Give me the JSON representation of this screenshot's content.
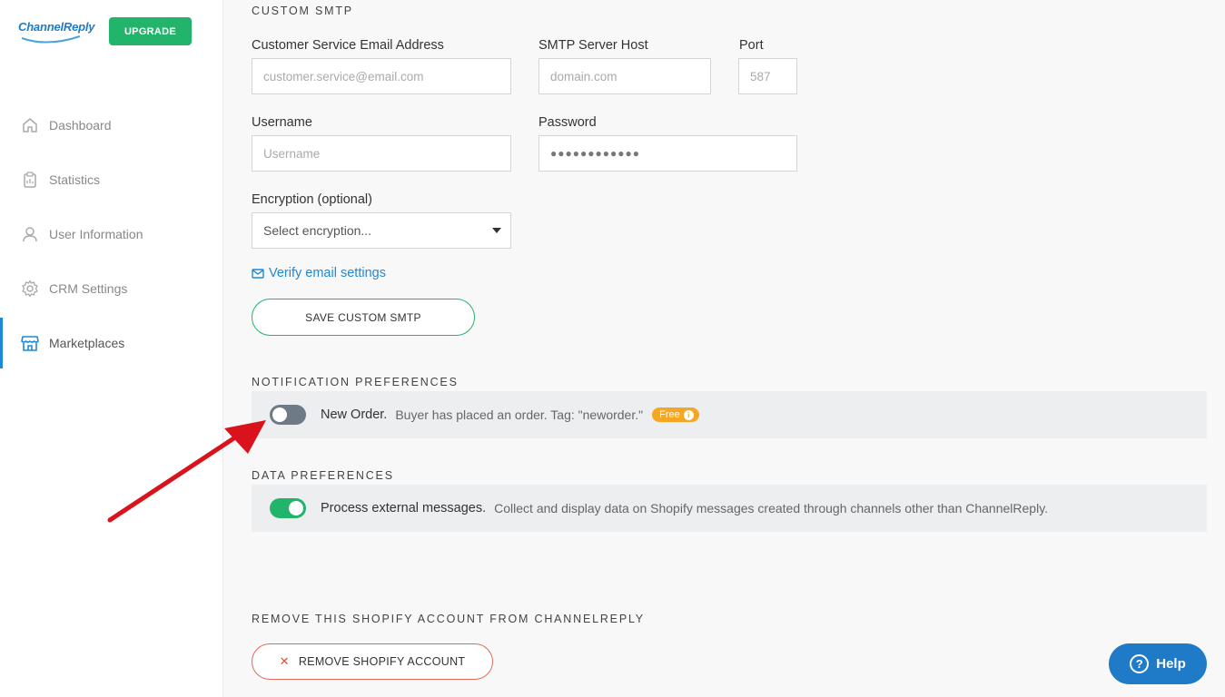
{
  "logo": {
    "text": "ChannelReply"
  },
  "upgrade": {
    "label": "UPGRADE"
  },
  "sidebar": {
    "items": [
      {
        "label": "Dashboard",
        "icon": "home-icon"
      },
      {
        "label": "Statistics",
        "icon": "clipboard-icon"
      },
      {
        "label": "User Information",
        "icon": "user-icon"
      },
      {
        "label": "CRM Settings",
        "icon": "gear-icon"
      },
      {
        "label": "Marketplaces",
        "icon": "store-icon",
        "active": true
      }
    ]
  },
  "smtp": {
    "section_title": "CUSTOM SMTP",
    "email_label": "Customer Service Email Address",
    "email_placeholder": "customer.service@email.com",
    "host_label": "SMTP Server Host",
    "host_placeholder": "domain.com",
    "port_label": "Port",
    "port_placeholder": "587",
    "username_label": "Username",
    "username_placeholder": "Username",
    "password_label": "Password",
    "password_value": "●●●●●●●●●●●●",
    "encryption_label": "Encryption (optional)",
    "encryption_selected": "Select encryption...",
    "verify_link": "Verify email settings",
    "save_label": "SAVE CUSTOM SMTP"
  },
  "notifications": {
    "section_title": "NOTIFICATION PREFERENCES",
    "new_order": {
      "title": "New Order.",
      "description": "Buyer has placed an order. Tag: \"neworder.\"",
      "badge": "Free",
      "enabled": false
    }
  },
  "data_prefs": {
    "section_title": "DATA PREFERENCES",
    "external": {
      "title": "Process external messages.",
      "description": "Collect and display data on Shopify messages created through channels other than ChannelReply.",
      "enabled": true
    }
  },
  "remove": {
    "section_title": "REMOVE THIS SHOPIFY ACCOUNT FROM CHANNELREPLY",
    "button_label": "REMOVE SHOPIFY ACCOUNT"
  },
  "help": {
    "label": "Help"
  },
  "colors": {
    "primary_blue": "#1f7bc7",
    "accent_green": "#22b46b",
    "badge_orange": "#f5a623",
    "danger_red": "#e0513c",
    "annotation_arrow": "#d9121b"
  }
}
